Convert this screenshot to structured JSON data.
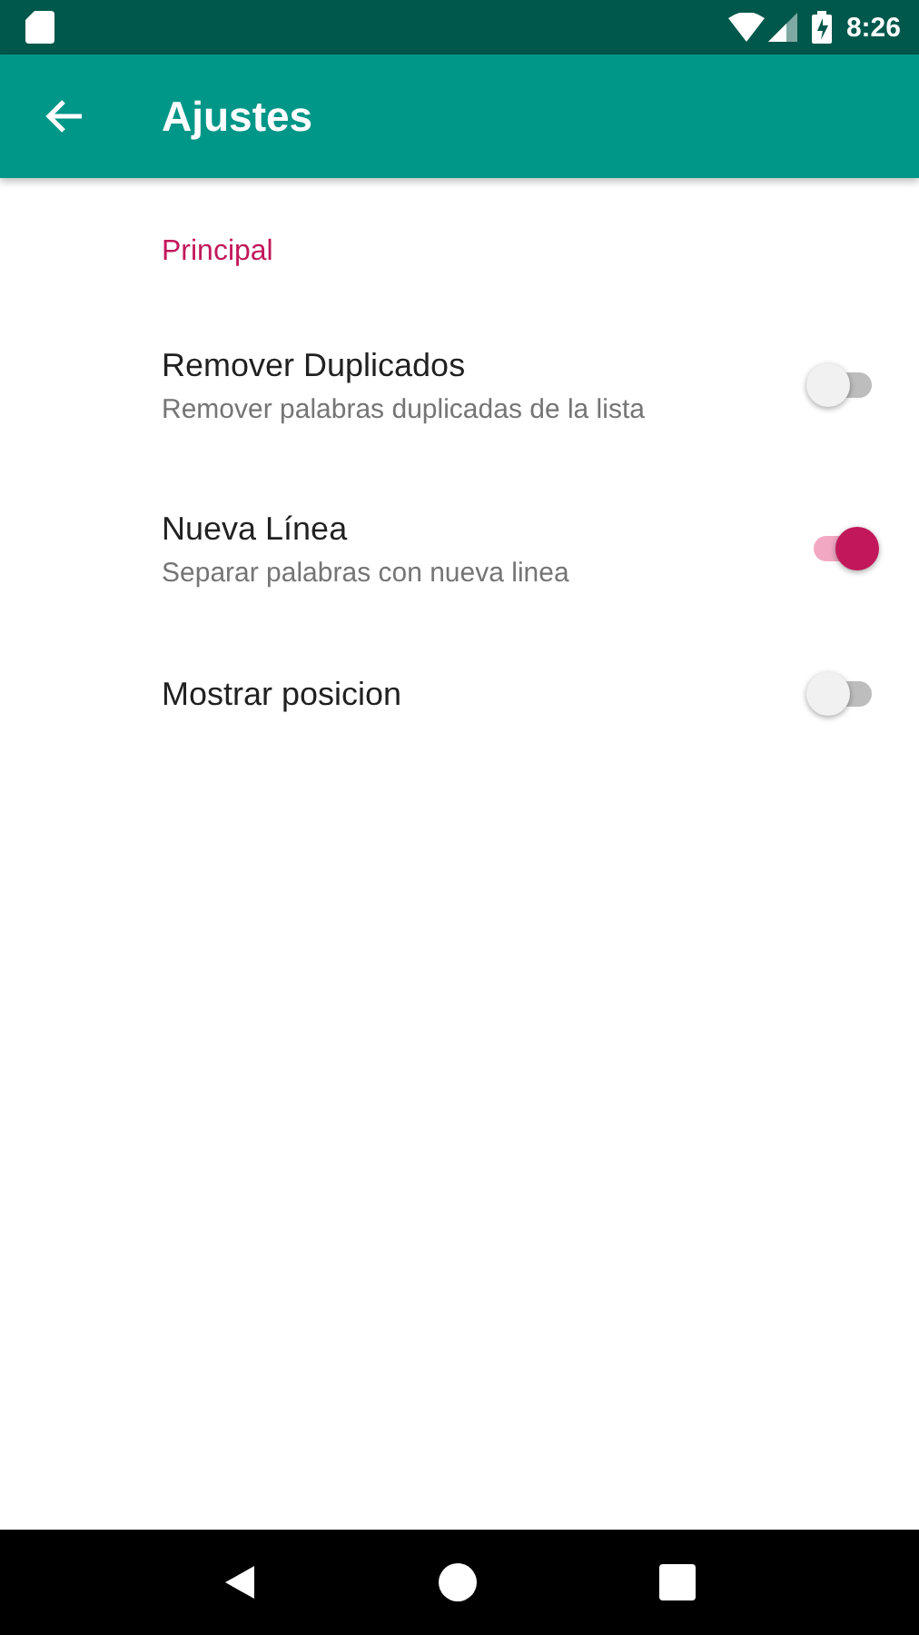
{
  "status_bar": {
    "time": "8:26"
  },
  "app_bar": {
    "title": "Ajustes"
  },
  "section": {
    "title": "Principal"
  },
  "settings": [
    {
      "title": "Remover Duplicados",
      "summary": "Remover palabras duplicadas de la lista",
      "on": false
    },
    {
      "title": "Nueva Línea",
      "summary": "Separar palabras con nueva linea",
      "on": true
    },
    {
      "title": "Mostrar posicion",
      "on": false
    }
  ]
}
